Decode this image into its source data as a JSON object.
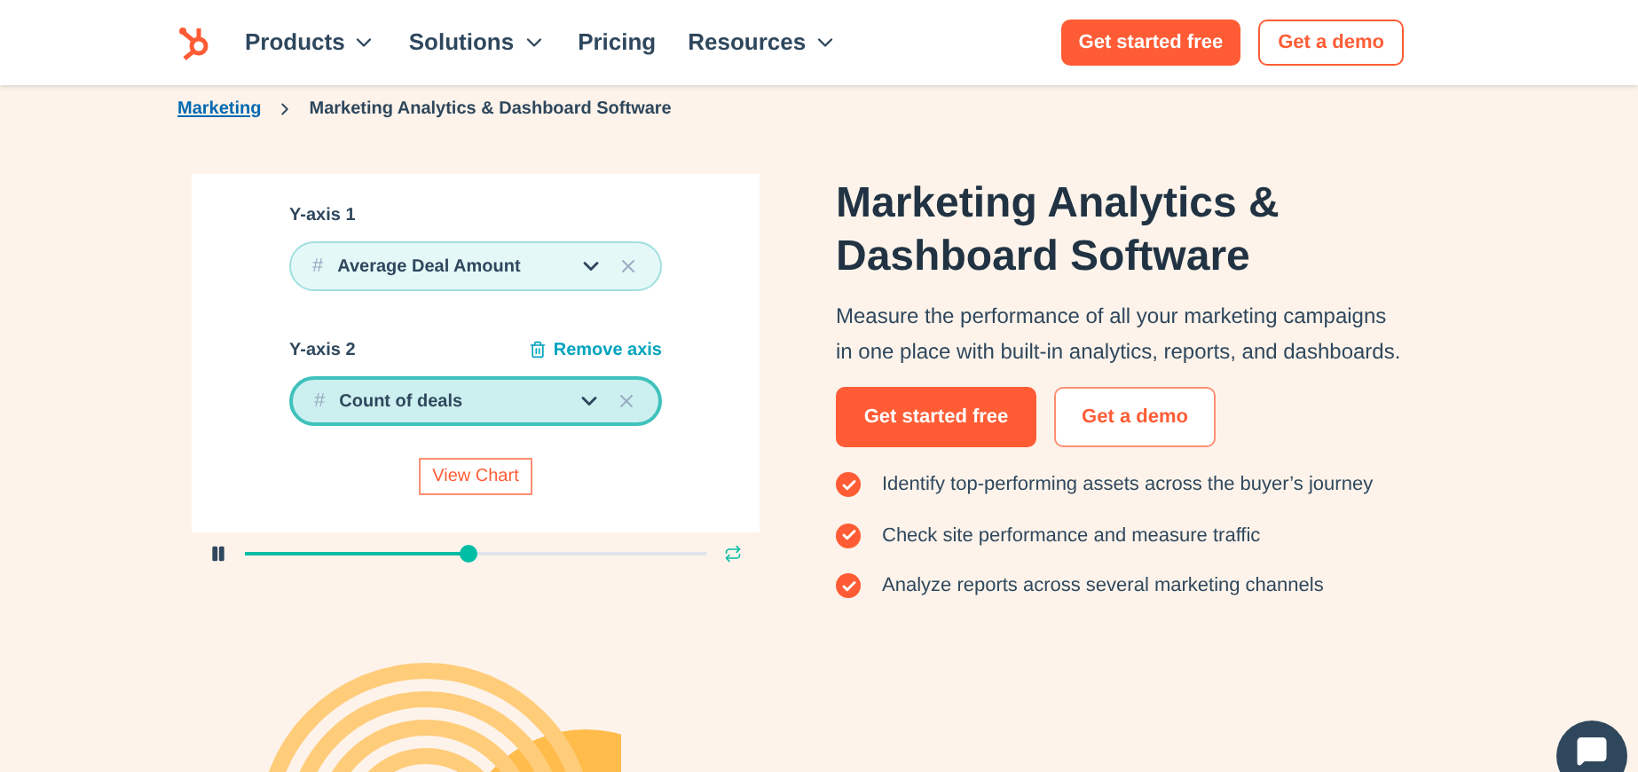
{
  "nav": {
    "items": [
      {
        "label": "Products",
        "dropdown": true
      },
      {
        "label": "Solutions",
        "dropdown": true
      },
      {
        "label": "Pricing",
        "dropdown": false
      },
      {
        "label": "Resources",
        "dropdown": true
      }
    ],
    "primary": "Get started free",
    "secondary": "Get a demo"
  },
  "breadcrumb": {
    "link": "Marketing",
    "current": "Marketing Analytics & Dashboard Software"
  },
  "demo": {
    "axes": [
      {
        "label": "Y-axis 1",
        "value": "Average Deal Amount",
        "active": false
      },
      {
        "label": "Y-axis 2",
        "value": "Count of deals",
        "active": true,
        "remove": "Remove axis"
      }
    ],
    "hash": "#",
    "button": "View Chart",
    "player": {
      "level": 0.485,
      "playing": true
    }
  },
  "hero": {
    "title": "Marketing Analytics & Dashboard Software",
    "text": "Measure the performance of all your marketing campaigns in one place with built-in analytics, reports, and dashboards.",
    "primary": "Get started free",
    "secondary": "Get a demo",
    "features": [
      "Identify top-performing assets across the buyer’s journey",
      "Check site performance and measure traffic",
      "Analyze reports across several marketing channels"
    ]
  }
}
